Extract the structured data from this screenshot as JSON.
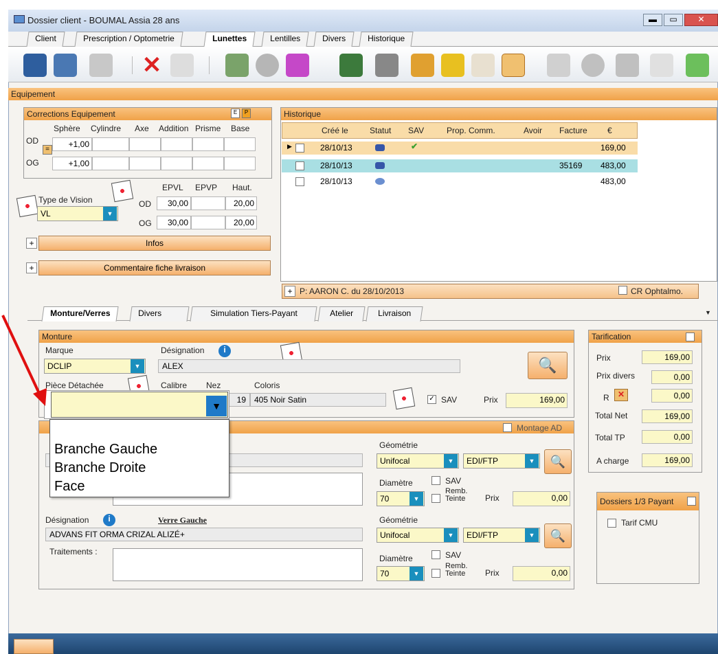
{
  "window": {
    "title": "Dossier client - BOUMAL Assia 28 ans"
  },
  "main_tabs": [
    "Client",
    "Prescription / Optometrie",
    "Lunettes",
    "Lentilles",
    "Divers",
    "Historique"
  ],
  "toolbar_icons": [
    "save-icon",
    "save-copy-icon",
    "print-icon",
    "delete-icon",
    "document-icon",
    "report-icon",
    "users-icon",
    "card-icon",
    "ivs-icon",
    "icom-icon",
    "hand-icon",
    "basket-icon",
    "envelope-icon",
    "glasses-icon",
    "calculator-icon",
    "search-tool-icon",
    "cash-register-icon",
    "export-icon",
    "exit-icon"
  ],
  "section_equipement": "Equipement",
  "corrections": {
    "title": "Corrections Equipement",
    "btn_e": "E",
    "btn_p": "P",
    "headers": [
      "Sphère",
      "Cylindre",
      "Axe",
      "Addition",
      "Prisme",
      "Base"
    ],
    "od_label": "OD",
    "og_label": "OG",
    "eq_btn": "=",
    "od_sphere": "+1,00",
    "og_sphere": "+1,00"
  },
  "vision": {
    "label": "Type de Vision",
    "value": "VL",
    "sav_badge": "SAV",
    "headers": [
      "EPVL",
      "EPVP",
      "Haut."
    ],
    "od_label": "OD",
    "og_label": "OG",
    "od_epvl": "30,00",
    "od_haut": "20,00",
    "og_epvl": "30,00",
    "og_haut": "20,00"
  },
  "infos_btn": "Infos",
  "comment_btn": "Commentaire fiche livraison",
  "historique": {
    "title": "Historique",
    "headers": [
      "Créé le",
      "Statut",
      "SAV",
      "Prop. Comm.",
      "Avoir",
      "Facture",
      "€"
    ],
    "rows": [
      {
        "date": "28/10/13",
        "facture": "",
        "amount": "169,00"
      },
      {
        "date": "28/10/13",
        "facture": "35169",
        "amount": "483,00"
      },
      {
        "date": "28/10/13",
        "facture": "",
        "amount": "483,00"
      }
    ]
  },
  "prescription_bar": {
    "text": "P: AARON C. du 28/10/2013",
    "cr_label": "CR Ophtalmo."
  },
  "sub_tabs": [
    "Monture/Verres",
    "Divers",
    "Simulation Tiers-Payant",
    "Atelier",
    "Livraison"
  ],
  "monture": {
    "title": "Monture",
    "marque_label": "Marque",
    "marque_value": "DCLIP",
    "designation_label": "Désignation",
    "designation_value": "ALEX",
    "piece_label": "Pièce Détachée",
    "calibre_label": "Calibre",
    "nez_label": "Nez",
    "nez_value": "19",
    "coloris_label": "Coloris",
    "coloris_value": "405 Noir Satin",
    "sav_label": "SAV",
    "prix_label": "Prix",
    "prix_value": "169,00"
  },
  "dropdown": {
    "options": [
      "Branche Gauche",
      "Branche Droite",
      "Face"
    ]
  },
  "verres": {
    "montage_label": "Montage AD",
    "geometrie_label": "Géométrie",
    "geometrie_value": "Unifocal",
    "geom2_value": "EDI/FTP",
    "diametre_label": "Diamètre",
    "diametre_value": "70",
    "sav_label": "SAV",
    "remb_label": "Remb. Teinte",
    "prix_label": "Prix",
    "prix_value": "0,00",
    "designation_label": "Désignation",
    "verre_gauche_label": "Verre Gauche",
    "verre_gauche_value": "ADVANS FIT ORMA CRIZAL ALIZÉ+",
    "traitements_label": "Traitements :"
  },
  "tarification": {
    "title": "Tarification",
    "rows": [
      {
        "label": "Prix",
        "value": "169,00"
      },
      {
        "label": "Prix divers",
        "value": "0,00"
      },
      {
        "label": "R",
        "value": "0,00"
      },
      {
        "label": "Total Net",
        "value": "169,00"
      },
      {
        "label": "Total TP",
        "value": "0,00"
      },
      {
        "label": "A charge",
        "value": "169,00"
      }
    ]
  },
  "dossiers": {
    "title": "Dossiers 1/3 Payant",
    "cmu_label": "Tarif CMU"
  }
}
